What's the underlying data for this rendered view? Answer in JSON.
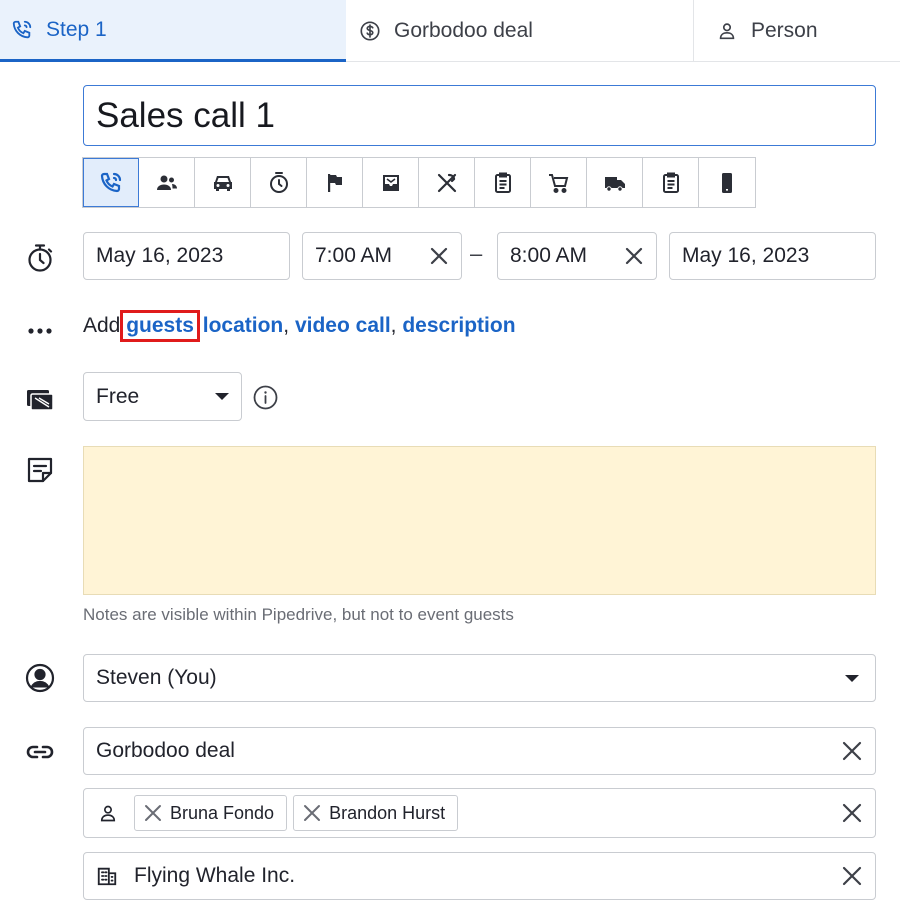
{
  "tabs": [
    {
      "label": "Step 1",
      "icon": "phone-call-icon",
      "active": true
    },
    {
      "label": "Gorbodoo deal",
      "icon": "dollar-circle-icon",
      "active": false
    },
    {
      "label": "Person",
      "icon": "person-icon",
      "active": false
    }
  ],
  "title": {
    "value": "Sales call 1"
  },
  "activity_types": [
    "call",
    "meeting",
    "car",
    "deadline",
    "flag",
    "email",
    "lunch",
    "task",
    "shopping-cart",
    "truck",
    "clipboard",
    "mobile"
  ],
  "schedule": {
    "start_date": "May 16, 2023",
    "start_time": "7:00 AM",
    "separator": "–",
    "end_time": "8:00 AM",
    "end_date": "May 16, 2023"
  },
  "add_row": {
    "prefix": "Add",
    "guests": "guests",
    "location": "location",
    "comma1": ",",
    "video_call": "video call",
    "comma2": ",",
    "description": "description"
  },
  "busy": {
    "value": "Free"
  },
  "note": {
    "hint": "Notes are visible within Pipedrive, but not to event guests"
  },
  "owner": {
    "value": "Steven (You)"
  },
  "links": {
    "deal": "Gorbodoo deal",
    "persons": [
      "Bruna Fondo",
      "Brandon Hurst"
    ],
    "organization": "Flying Whale Inc."
  },
  "colors": {
    "accent": "#1b64c6",
    "note_bg": "#fff4d6",
    "highlight": "#e01b1b"
  }
}
